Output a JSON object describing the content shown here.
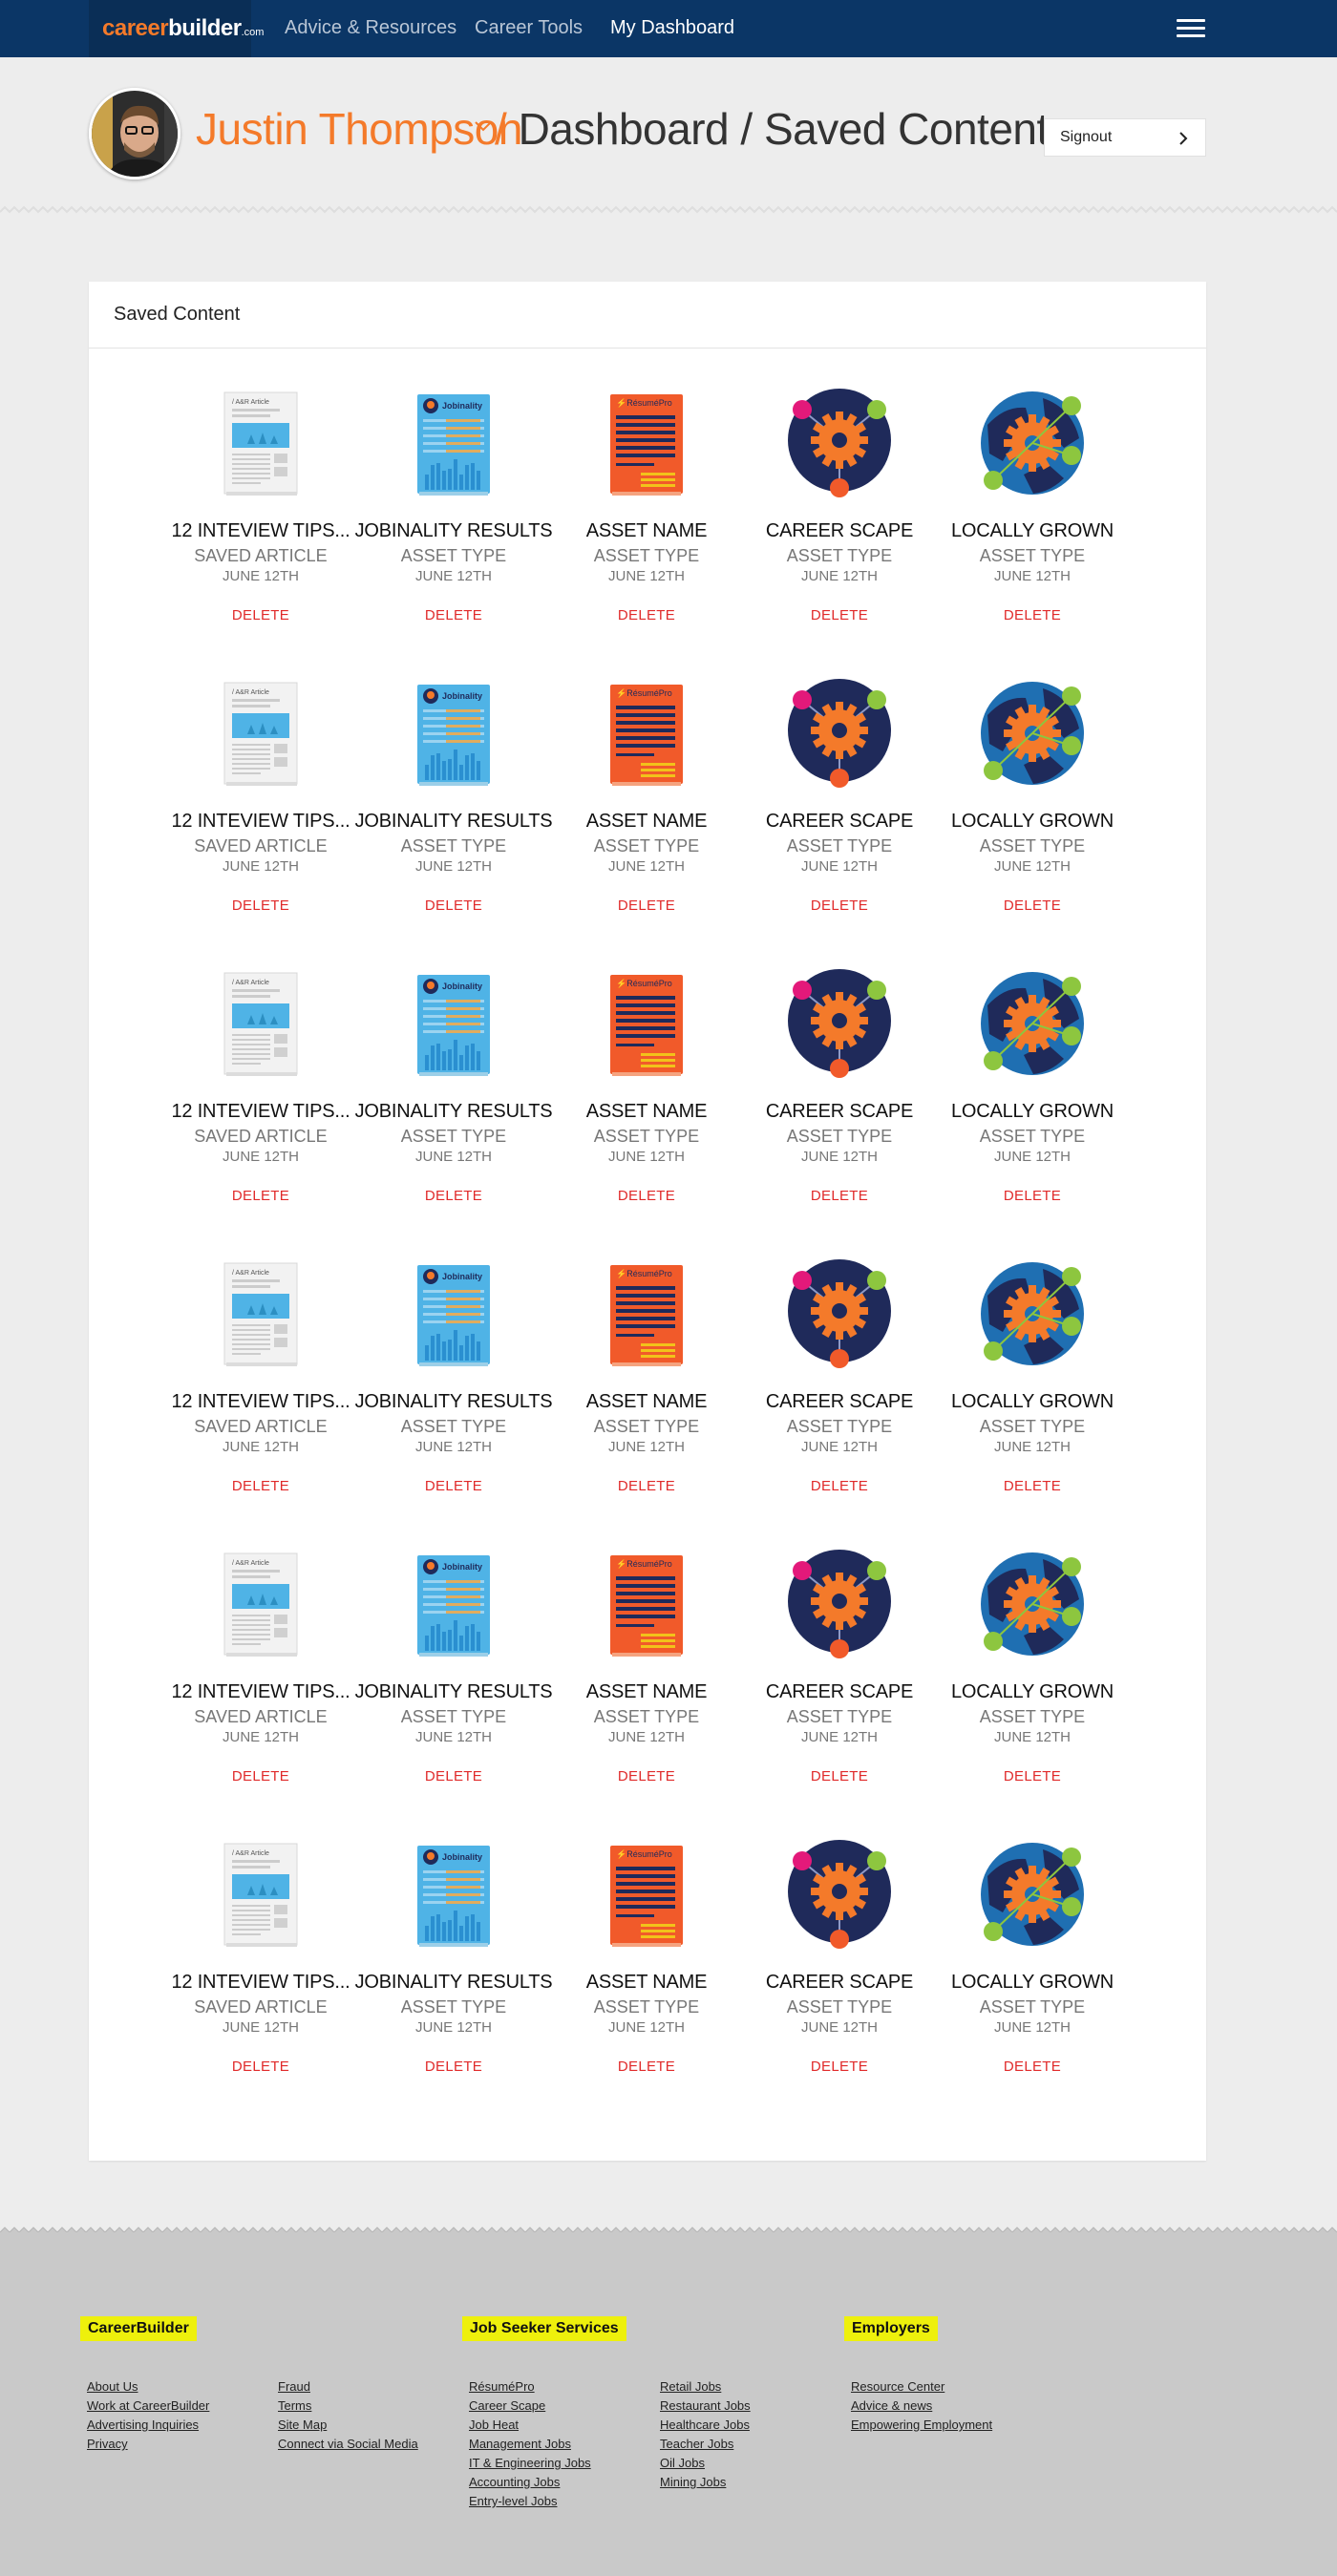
{
  "topnav": {
    "logo_career": "career",
    "logo_builder": "builder",
    "logo_dotcom": ".com",
    "links": [
      "Advice & Resources",
      "Career Tools",
      "My Dashboard"
    ],
    "active_link": "My Dashboard",
    "bg_color": "#0b3666"
  },
  "header": {
    "user_name": "Justin Thompson",
    "separator": "/",
    "crumb_dashboard": "Dashboard",
    "crumb_saved": "Saved Content",
    "signout_label": "Signout",
    "accent_color": "#f47a2a"
  },
  "card": {
    "title": "Saved Content",
    "delete_color": "#e02a2a",
    "rows": [
      [
        {
          "title": "12 INTEVIEW TIPS...",
          "type": "SAVED ARTICLE",
          "date": "JUNE 12TH",
          "action": "DELETE",
          "icon": "article-icon"
        },
        {
          "title": "JOBINALITY RESULTS",
          "type": "ASSET TYPE",
          "date": "JUNE 12TH",
          "action": "DELETE",
          "icon": "jobinality-icon"
        },
        {
          "title": "ASSET NAME",
          "type": "ASSET TYPE",
          "date": "JUNE 12TH",
          "action": "DELETE",
          "icon": "resumepro-icon"
        },
        {
          "title": "CAREER SCAPE",
          "type": "ASSET TYPE",
          "date": "JUNE 12TH",
          "action": "DELETE",
          "icon": "career-scape-icon"
        },
        {
          "title": "LOCALLY GROWN",
          "type": "ASSET TYPE",
          "date": "JUNE 12TH",
          "action": "DELETE",
          "icon": "globe-gear-icon"
        }
      ],
      [
        {
          "title": "12 INTEVIEW TIPS...",
          "type": "SAVED ARTICLE",
          "date": "JUNE 12TH",
          "action": "DELETE",
          "icon": "article-icon"
        },
        {
          "title": "JOBINALITY RESULTS",
          "type": "ASSET TYPE",
          "date": "JUNE 12TH",
          "action": "DELETE",
          "icon": "jobinality-icon"
        },
        {
          "title": "ASSET NAME",
          "type": "ASSET TYPE",
          "date": "JUNE 12TH",
          "action": "DELETE",
          "icon": "resumepro-icon"
        },
        {
          "title": "CAREER SCAPE",
          "type": "ASSET TYPE",
          "date": "JUNE 12TH",
          "action": "DELETE",
          "icon": "career-scape-icon"
        },
        {
          "title": "LOCALLY GROWN",
          "type": "ASSET TYPE",
          "date": "JUNE 12TH",
          "action": "DELETE",
          "icon": "globe-gear-icon"
        }
      ],
      [
        {
          "title": "12 INTEVIEW TIPS...",
          "type": "SAVED ARTICLE",
          "date": "JUNE 12TH",
          "action": "DELETE",
          "icon": "article-icon"
        },
        {
          "title": "JOBINALITY RESULTS",
          "type": "ASSET TYPE",
          "date": "JUNE 12TH",
          "action": "DELETE",
          "icon": "jobinality-icon"
        },
        {
          "title": "ASSET NAME",
          "type": "ASSET TYPE",
          "date": "JUNE 12TH",
          "action": "DELETE",
          "icon": "resumepro-icon"
        },
        {
          "title": "CAREER SCAPE",
          "type": "ASSET TYPE",
          "date": "JUNE 12TH",
          "action": "DELETE",
          "icon": "career-scape-icon"
        },
        {
          "title": "LOCALLY GROWN",
          "type": "ASSET TYPE",
          "date": "JUNE 12TH",
          "action": "DELETE",
          "icon": "globe-gear-icon"
        }
      ],
      [
        {
          "title": "12 INTEVIEW TIPS...",
          "type": "SAVED ARTICLE",
          "date": "JUNE 12TH",
          "action": "DELETE",
          "icon": "article-icon"
        },
        {
          "title": "JOBINALITY RESULTS",
          "type": "ASSET TYPE",
          "date": "JUNE 12TH",
          "action": "DELETE",
          "icon": "jobinality-icon"
        },
        {
          "title": "ASSET NAME",
          "type": "ASSET TYPE",
          "date": "JUNE 12TH",
          "action": "DELETE",
          "icon": "resumepro-icon"
        },
        {
          "title": "CAREER SCAPE",
          "type": "ASSET TYPE",
          "date": "JUNE 12TH",
          "action": "DELETE",
          "icon": "career-scape-icon"
        },
        {
          "title": "LOCALLY GROWN",
          "type": "ASSET TYPE",
          "date": "JUNE 12TH",
          "action": "DELETE",
          "icon": "globe-gear-icon"
        }
      ],
      [
        {
          "title": "12 INTEVIEW TIPS...",
          "type": "SAVED ARTICLE",
          "date": "JUNE 12TH",
          "action": "DELETE",
          "icon": "article-icon"
        },
        {
          "title": "JOBINALITY RESULTS",
          "type": "ASSET TYPE",
          "date": "JUNE 12TH",
          "action": "DELETE",
          "icon": "jobinality-icon"
        },
        {
          "title": "ASSET NAME",
          "type": "ASSET TYPE",
          "date": "JUNE 12TH",
          "action": "DELETE",
          "icon": "resumepro-icon"
        },
        {
          "title": "CAREER SCAPE",
          "type": "ASSET TYPE",
          "date": "JUNE 12TH",
          "action": "DELETE",
          "icon": "career-scape-icon"
        },
        {
          "title": "LOCALLY GROWN",
          "type": "ASSET TYPE",
          "date": "JUNE 12TH",
          "action": "DELETE",
          "icon": "globe-gear-icon"
        }
      ],
      [
        {
          "title": "12 INTEVIEW TIPS...",
          "type": "SAVED ARTICLE",
          "date": "JUNE 12TH",
          "action": "DELETE",
          "icon": "article-icon"
        },
        {
          "title": "JOBINALITY RESULTS",
          "type": "ASSET TYPE",
          "date": "JUNE 12TH",
          "action": "DELETE",
          "icon": "jobinality-icon"
        },
        {
          "title": "ASSET NAME",
          "type": "ASSET TYPE",
          "date": "JUNE 12TH",
          "action": "DELETE",
          "icon": "resumepro-icon"
        },
        {
          "title": "CAREER SCAPE",
          "type": "ASSET TYPE",
          "date": "JUNE 12TH",
          "action": "DELETE",
          "icon": "career-scape-icon"
        },
        {
          "title": "LOCALLY GROWN",
          "type": "ASSET TYPE",
          "date": "JUNE 12TH",
          "action": "DELETE",
          "icon": "globe-gear-icon"
        }
      ]
    ],
    "thumb_labels": {
      "article": "/ A&R Article",
      "jobinality": "Jobinality",
      "resumepro": "RésuméPro"
    }
  },
  "footer": {
    "bg_color": "#c9c9c9",
    "highlight_color": "#eef00c",
    "sections": [
      {
        "heading": "CareerBuilder",
        "columns": [
          [
            "About Us",
            "Work at CareerBuilder",
            "Advertising Inquiries",
            "Privacy"
          ],
          [
            "Fraud",
            "Terms",
            "Site Map",
            "Connect via Social Media"
          ]
        ]
      },
      {
        "heading": "Job Seeker Services",
        "columns": [
          [
            "RésuméPro",
            "Career Scape",
            "Job Heat",
            "Management Jobs",
            "IT & Engineering Jobs",
            "Accounting Jobs",
            "Entry-level Jobs"
          ],
          [
            "Retail Jobs",
            "Restaurant Jobs",
            "Healthcare Jobs",
            "Teacher Jobs",
            "Oil Jobs",
            "Mining Jobs"
          ]
        ]
      },
      {
        "heading": "Employers",
        "columns": [
          [
            "Resource Center",
            "Advice & news",
            "Empowering Employment"
          ]
        ]
      }
    ]
  }
}
